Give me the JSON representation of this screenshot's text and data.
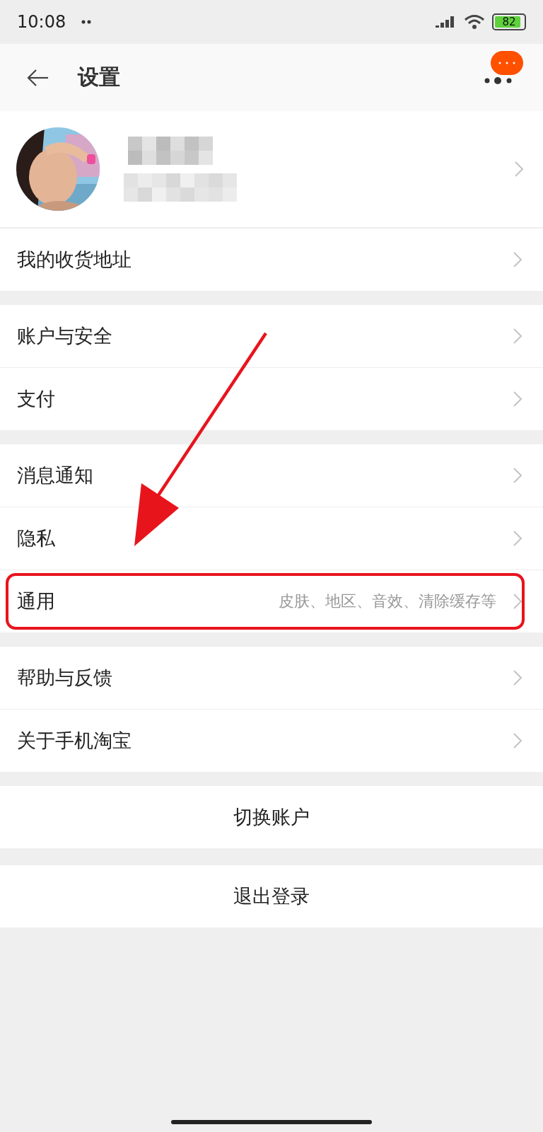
{
  "status_bar": {
    "time": "10:08",
    "battery": "82"
  },
  "header": {
    "title": "设置"
  },
  "profile": {
    "kind": "picture",
    "redacted": true
  },
  "sections": [
    {
      "items": [
        {
          "label": "我的收货地址",
          "highlighted": false
        }
      ]
    },
    {
      "items": [
        {
          "label": "账户与安全",
          "highlighted": false
        },
        {
          "label": "支付",
          "highlighted": false
        }
      ]
    },
    {
      "items": [
        {
          "label": "消息通知",
          "highlighted": false
        },
        {
          "label": "隐私",
          "highlighted": false
        },
        {
          "label": "通用",
          "detail": "皮肤、地区、音效、清除缓存等",
          "highlighted": true
        }
      ]
    },
    {
      "items": [
        {
          "label": "帮助与反馈",
          "highlighted": false
        },
        {
          "label": "关于手机淘宝",
          "highlighted": false
        }
      ]
    }
  ],
  "actions": [
    {
      "label": "切换账户"
    },
    {
      "label": "退出登录"
    }
  ]
}
